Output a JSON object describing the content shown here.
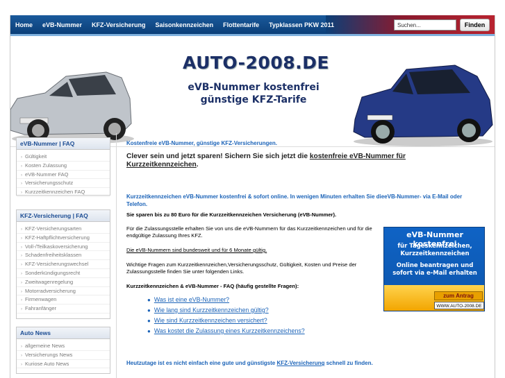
{
  "nav": {
    "items": [
      "Home",
      "eVB-Nummer",
      "KFZ-Versicherung",
      "Saisonkennzeichen",
      "Flottentarife",
      "Typklassen PKW 2011"
    ],
    "search_placeholder": "Suchen...",
    "search_button": "Finden"
  },
  "banner": {
    "title": "AUTO-2008.DE",
    "tagline1": "eVB-Nummer kostenfrei",
    "tagline2": "günstige KFZ-Tarife"
  },
  "sidebar": [
    {
      "heading": "eVB-Nummer | FAQ",
      "items": [
        "Gültigkeit",
        "Kosten Zulassung",
        "eVB-Nummer FAQ",
        "Versicherungsschutz",
        "Kurzzeitkennzeichen FAQ"
      ]
    },
    {
      "heading": "KFZ-Versicherung | FAQ",
      "items": [
        "KFZ-Versicherungsarten",
        "KFZ-Haftpflichtversicherung",
        "Voll-/Teilkaskoversicherung",
        "Schadenfreiheitsklassen",
        "KFZ-Versicherungswechsel",
        "Sonderkündigungsrecht",
        "Zweitwagenregelung",
        "Motorradversicherung",
        "Firmenwagen",
        "Fahranfänger"
      ]
    },
    {
      "heading": "Auto News",
      "items": [
        "allgemeine News",
        "Versicherungs News",
        "Kuriose Auto News"
      ]
    }
  ],
  "main": {
    "heading": "Kostenfreie eVB-Nummer, günstige KFZ-Versicherungen.",
    "intro_prefix": "Clever sein und jetzt sparen! Sichern Sie sich jetzt die ",
    "intro_link": "kostenfreie eVB-Nummer für Kurzzeitkennzeichen",
    "intro_suffix": ".",
    "subheading": "Kurzzeitkennzeichen eVB-Nummer kostenfrei & sofort online. In wenigen Minuten erhalten Sie dieeVB-Nummer- via E-Mail oder Telefon.",
    "bold_line": "Sie sparen bis zu 80 Euro für die Kurzzeitkennzeichen Versicherung (eVB-Nummer).",
    "para1": "Für die Zulassungsstelle erhalten Sie von uns die eVB-Nummern für das Kurzzeitkennzeichen und für die endgültige Zulassung Ihres KFZ.",
    "para2": "Die eVB-Nummern sind bundesweit und für 6 Monate gültig.",
    "para3": "Wichtige Fragen zum Kurzzeitkennzeichen,Versicherungsschutz, Gültigkeit, Kosten und Preise der Zulassungsstelle finden Sie unter folgenden Links.",
    "faq_heading": "Kurzzeitkennzeichen & eVB-Nummer - FAQ (häufig gestellte Fragen):",
    "faq_links": [
      "Was ist eine eVB-Nummer?",
      "Wie lang sind Kurzzeitkennzeichen gültig?",
      "Wie sind Kurzzeitkennzeichen versichert?",
      "Was kostet die Zulassung eines Kurzzeitkennzeichens?"
    ],
    "footer_prefix": "Heutzutage ist es nicht einfach eine gute und günstigste ",
    "footer_link": "KFZ-Versicherung",
    "footer_suffix": " schnell zu finden."
  },
  "ad": {
    "title": "eVB-Nummer kostenfrei",
    "line1": "für Tageskennzeichen,",
    "line2": "Kurzzeitkennzeichen",
    "line3": "Online beantragen und",
    "line4": "sofort via e-Mail erhalten",
    "cta": "zum Antrag",
    "url": "WWW.AUTO-2008.DE"
  },
  "colors": {
    "nav": "#0b3f78",
    "accent": "#1b63b8",
    "title": "#1b2f66",
    "ad": "#0f63c5"
  }
}
